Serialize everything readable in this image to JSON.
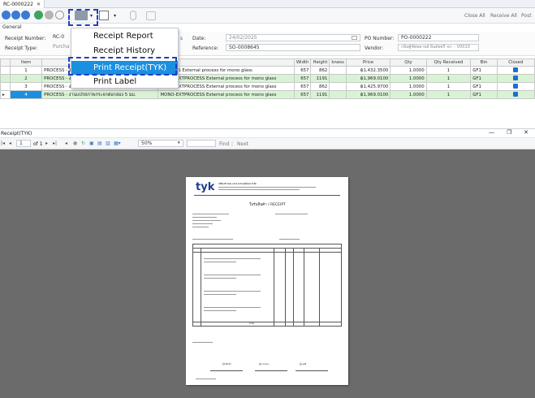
{
  "tab": {
    "title": "RC-0000222"
  },
  "toolbar": {
    "right_actions": [
      "Close All",
      "Receive All",
      "Post"
    ]
  },
  "form": {
    "section_label": "General",
    "receipt_number_label": "Receipt Number:",
    "receipt_number_value": "RC-0",
    "receipt_type_label": "Receipt Type:",
    "receipt_type_value": "Purcha",
    "date_label": "Date:",
    "date_value": "24/02/2025",
    "reference_label": "Reference:",
    "reference_value": "SO-0008645",
    "po_number_label": "PO Number:",
    "po_number_value": "PO-0000222",
    "vendor_label": "Vendor:",
    "vendor_value": "กนิษฐ์ซัพพลายส์ อินดัสตรี้ จก. - V0010"
  },
  "grid": {
    "headers": [
      "Item",
      "",
      "",
      "Width",
      "Height",
      "kness",
      "Price",
      "Qty",
      "Qty Received",
      "Bin",
      "Closed"
    ],
    "rows": [
      {
        "item": "1",
        "desc": "PROCESS - งานแปรสภาพกระจกด้วยเครื่องโมโน",
        "process": "PROCESS External process for mono glass",
        "width": "657",
        "height": "862",
        "price": "฿1,432.3500",
        "qty": "1.0000",
        "received": "1",
        "bin": "GF1"
      },
      {
        "item": "2",
        "desc": "PROCESS - งานแปรสภาพกระจกด้วยเครื่องโมโน",
        "process": "MONO-EXTPROCESS External process for mono glass",
        "width": "657",
        "height": "1191",
        "price": "฿1,969.0100",
        "qty": "1.0000",
        "received": "1",
        "bin": "GF1"
      },
      {
        "item": "3",
        "desc": "PROCESS - งานแปรสภาพกระจกต่อกล่อง 5 มม.",
        "process": "MONO-EXTPROCESS External process for mono glass",
        "width": "657",
        "height": "862",
        "price": "฿1,425.9700",
        "qty": "1.0000",
        "received": "1",
        "bin": "GF1"
      },
      {
        "item": "4",
        "desc": "PROCESS - งานแปรสภาพกระจกต่อกล่อง 5 มม.",
        "process": "MONO-EXTPROCESS External process for mono glass",
        "width": "657",
        "height": "1191",
        "price": "฿1,969.0100",
        "qty": "1.0000",
        "received": "1",
        "bin": "GF1"
      }
    ]
  },
  "menu": {
    "items": [
      "Receipt Report",
      "Receipt History",
      "Print Receipt(TYK)",
      "Print Label"
    ],
    "highlighted_index": 2
  },
  "viewer": {
    "title": "Receipt(TYK)",
    "page_current": "1",
    "page_total": "of 1",
    "zoom": "50%",
    "find_label": "Find",
    "next_label": "Next"
  },
  "report": {
    "logo": "tyk",
    "company_line": "บริษัท ทีวายเค กลาส (ประเทศไทย) จำกัด",
    "title": "ใบรับสินค้า / RECEIPT",
    "total_label": "Total",
    "signatures": [
      "ผู้รับสินค้า",
      "ผู้ตรวจสอบ",
      "ผู้อนุมัติ"
    ]
  },
  "colors": {
    "accent": "#1b8fe0",
    "alt_row": "#d8f3d4",
    "viewer_bg": "#6b6b6b",
    "highlight_border": "#1f3fc2"
  }
}
